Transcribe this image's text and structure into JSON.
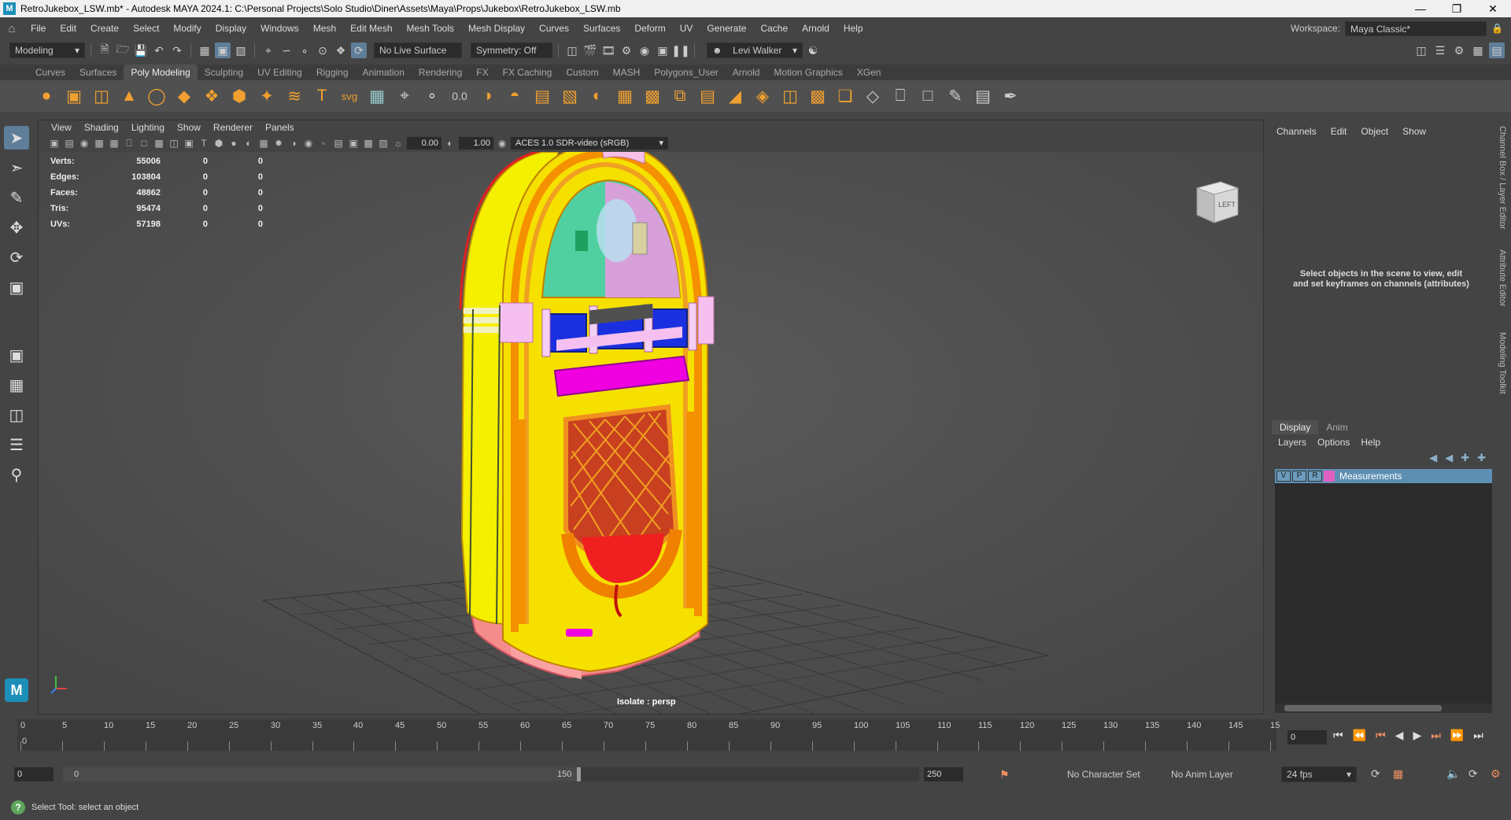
{
  "window": {
    "title": "RetroJukebox_LSW.mb* - Autodesk MAYA 2024.1: C:\\Personal Projects\\Solo Studio\\Diner\\Assets\\Maya\\Props\\Jukebox\\RetroJukebox_LSW.mb",
    "app_icon": "M"
  },
  "menu": [
    "File",
    "Edit",
    "Create",
    "Select",
    "Modify",
    "Display",
    "Windows",
    "Mesh",
    "Edit Mesh",
    "Mesh Tools",
    "Mesh Display",
    "Curves",
    "Surfaces",
    "Deform",
    "UV",
    "Generate",
    "Cache",
    "Arnold",
    "Help"
  ],
  "workspace": {
    "label": "Workspace:",
    "value": "Maya Classic*"
  },
  "status": {
    "mode": "Modeling",
    "live_surface": "No Live Surface",
    "symmetry": "Symmetry: Off",
    "user": "Levi Walker"
  },
  "shelf_tabs": [
    "Curves",
    "Surfaces",
    "Poly Modeling",
    "Sculpting",
    "UV Editing",
    "Rigging",
    "Animation",
    "Rendering",
    "FX",
    "FX Caching",
    "Custom",
    "MASH",
    "Polygons_User",
    "Arnold",
    "Motion Graphics",
    "XGen"
  ],
  "shelf_active": "Poly Modeling",
  "viewport": {
    "menu": [
      "View",
      "Shading",
      "Lighting",
      "Show",
      "Renderer",
      "Panels"
    ],
    "exposure": "0.00",
    "gamma": "1.00",
    "colorspace": "ACES 1.0 SDR-video (sRGB)",
    "isolate_label": "Isolate : persp",
    "viewcube_face": "LEFT",
    "hud": [
      {
        "label": "Verts:",
        "v1": "55006",
        "v2": "0",
        "v3": "0"
      },
      {
        "label": "Edges:",
        "v1": "103804",
        "v2": "0",
        "v3": "0"
      },
      {
        "label": "Faces:",
        "v1": "48862",
        "v2": "0",
        "v3": "0"
      },
      {
        "label": "Tris:",
        "v1": "95474",
        "v2": "0",
        "v3": "0"
      },
      {
        "label": "UVs:",
        "v1": "57198",
        "v2": "0",
        "v3": "0"
      }
    ]
  },
  "channel_box": {
    "menu": [
      "Channels",
      "Edit",
      "Object",
      "Show"
    ],
    "message_line1": "Select objects in the scene to view, edit",
    "message_line2": "and set keyframes on channels (attributes)"
  },
  "layer_editor": {
    "tabs": [
      "Display",
      "Anim"
    ],
    "menu": [
      "Layers",
      "Options",
      "Help"
    ],
    "layers": [
      {
        "v": "V",
        "p": "P",
        "r": "R",
        "name": "Measurements",
        "color": "#e060c0"
      }
    ]
  },
  "side_tabs": [
    "Channel Box / Layer Editor",
    "Attribute Editor",
    "Modeling Toolkit"
  ],
  "timeline": {
    "ticks": [
      "0",
      "5",
      "10",
      "15",
      "20",
      "25",
      "30",
      "35",
      "40",
      "45",
      "50",
      "55",
      "60",
      "65",
      "70",
      "75",
      "80",
      "85",
      "90",
      "95",
      "100",
      "105",
      "110",
      "115",
      "120",
      "125",
      "130",
      "135",
      "140",
      "145",
      "15"
    ],
    "current_frame_left": "0",
    "current_frame_right": "0"
  },
  "range": {
    "start": "0",
    "inner_start": "0",
    "inner_end": "150",
    "end": "250",
    "character_set": "No Character Set",
    "anim_layer": "No Anim Layer",
    "fps": "24 fps"
  },
  "helpline": {
    "text": "Select Tool: select an object"
  }
}
